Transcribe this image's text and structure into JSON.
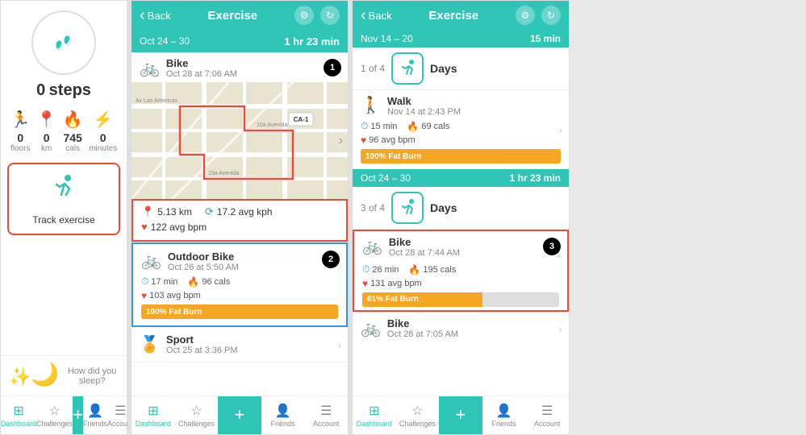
{
  "panel_left": {
    "steps": {
      "count": "0",
      "label": "steps"
    },
    "stats": [
      {
        "icon": "🏃",
        "value": "0",
        "label": "floors"
      },
      {
        "icon": "📍",
        "value": "0",
        "label": "km"
      },
      {
        "icon": "🔥",
        "value": "745",
        "label": "cals"
      },
      {
        "icon": "⚡",
        "value": "0",
        "label": "minutes"
      }
    ],
    "track_exercise": {
      "label": "Track exercise"
    },
    "sleep": {
      "label": "How did you sleep?"
    },
    "nav": [
      {
        "label": "Dashboard",
        "active": true
      },
      {
        "label": "Challenges"
      },
      {
        "label": "+",
        "is_add": true
      },
      {
        "label": "Friends"
      },
      {
        "label": "Account"
      }
    ]
  },
  "panel_mid": {
    "header": {
      "back": "Back",
      "title": "Exercise"
    },
    "date_range": "Oct 24 – 30",
    "duration": "1 hr 23 min",
    "entries": [
      {
        "type": "Bike",
        "date": "Oct 28 at 7:06 AM",
        "badge": "1",
        "stats": {
          "distance": "5.13 km",
          "speed": "17.2 avg kph",
          "bpm": "122 avg bpm"
        }
      },
      {
        "type": "Outdoor Bike",
        "date": "Oct 26 at 5:50 AM",
        "badge": "2",
        "duration": "17 min",
        "cals": "96 cals",
        "bpm": "103 avg bpm",
        "fat_burn": "100% Fat Burn",
        "fat_burn_pct": 100
      },
      {
        "type": "Sport",
        "date": "Oct 25 at 3:36 PM"
      }
    ],
    "nav": [
      {
        "label": "Dashboard",
        "active": true
      },
      {
        "label": "Challenges"
      },
      {
        "label": "+",
        "is_add": true
      },
      {
        "label": "Friends"
      },
      {
        "label": "Account"
      }
    ]
  },
  "panel_right": {
    "header": {
      "back": "Back",
      "title": "Exercise"
    },
    "week1": {
      "date_range": "Nov 14 – 20",
      "duration": "15 min",
      "fraction": "1 of 4",
      "days_label": "Days",
      "entry": {
        "type": "Walk",
        "date": "Nov 14 at 2:43 PM",
        "duration": "15 min",
        "cals": "69 cals",
        "bpm": "96 avg bpm",
        "fat_burn": "100% Fat Burn",
        "fat_burn_pct": 100
      }
    },
    "week2": {
      "date_range": "Oct 24 – 30",
      "duration": "1 hr 23 min",
      "fraction": "3 of 4",
      "days_label": "Days",
      "entry": {
        "type": "Bike",
        "date": "Oct 28 at 7:44 AM",
        "badge": "3",
        "duration": "26 min",
        "cals": "195 cals",
        "bpm": "131 avg bpm",
        "fat_burn": "61% Fat Burn",
        "fat_burn_pct": 61
      }
    },
    "week3": {
      "entry": {
        "type": "Bike",
        "date": "Oct 28 at 7:05 AM"
      }
    },
    "nav": [
      {
        "label": "Dashboard",
        "active": true
      },
      {
        "label": "Challenges"
      },
      {
        "label": "+",
        "is_add": true
      },
      {
        "label": "Friends"
      },
      {
        "label": "Account"
      }
    ]
  }
}
